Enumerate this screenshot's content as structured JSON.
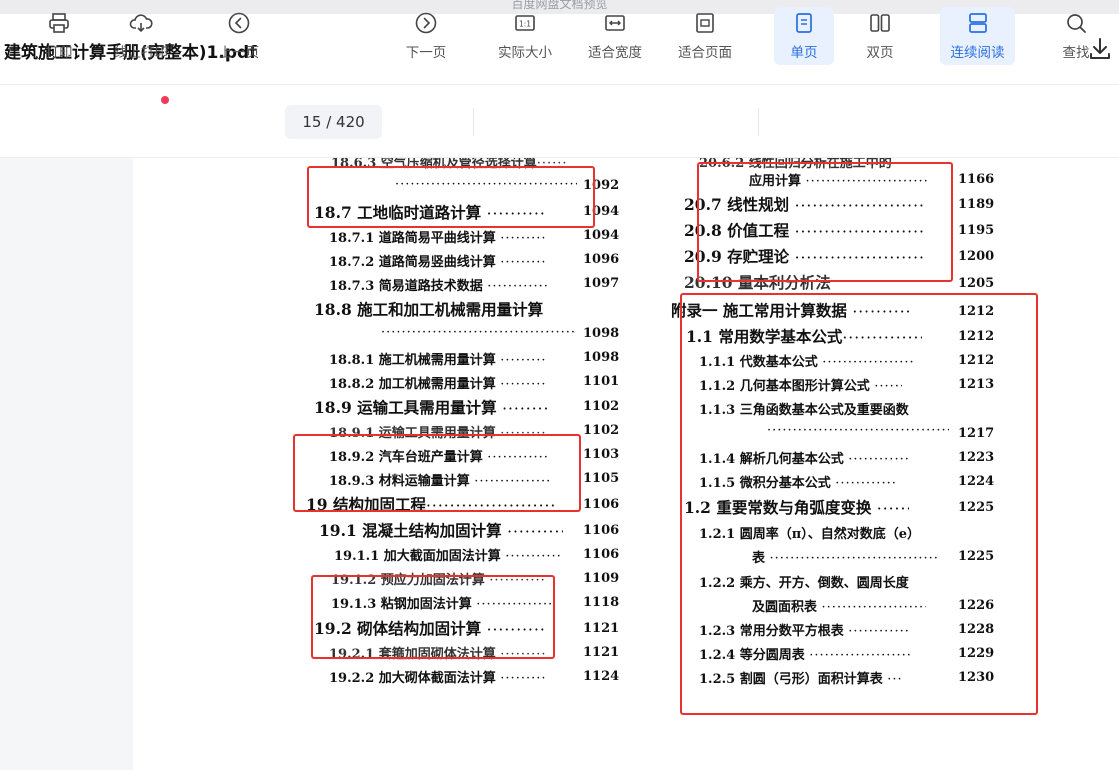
{
  "window": {
    "top_caption": "百度网盘文档预览",
    "doc_title": "建筑施工计算手册(完整本)1.pdf"
  },
  "toolbar": {
    "print": "打印",
    "online_print": "线上打印",
    "prev_page": "上一页",
    "page_indicator": "15 / 420",
    "next_page": "下一页",
    "actual_size": "实际大小",
    "fit_width": "适合宽度",
    "fit_page": "适合页面",
    "single_page": "单页",
    "double_page": "双页",
    "continuous": "连续阅读",
    "search": "查找",
    "actual_size_glyph": "1:1"
  },
  "toc_left": [
    {
      "text": "18.6.3  空气压缩机及管径选择计算",
      "page": ""
    },
    {
      "text": "",
      "page": "1092"
    },
    {
      "text": "18.7   工地临时道路计算",
      "page": "1094"
    },
    {
      "text": "18.7.1   道路简易平曲线计算",
      "page": "1094"
    },
    {
      "text": "18.7.2   道路简易竖曲线计算",
      "page": "1096"
    },
    {
      "text": "18.7.3   简易道路技术数据",
      "page": "1097"
    },
    {
      "text": "18.8   施工和加工机械需用量计算",
      "page": ""
    },
    {
      "text": "",
      "page": "1098"
    },
    {
      "text": "18.8.1   施工机械需用量计算",
      "page": "1098"
    },
    {
      "text": "18.8.2   加工机械需用量计算",
      "page": "1101"
    },
    {
      "text": "18.9   运输工具需用量计算",
      "page": "1102"
    },
    {
      "text": "18.9.1   运输工具需用量计算",
      "page": "1102"
    },
    {
      "text": "18.9.2   汽车台班产量计算",
      "page": "1103"
    },
    {
      "text": "18.9.3   材料运输量计算",
      "page": "1105"
    },
    {
      "text": "19   结构加固工程",
      "page": "1106"
    },
    {
      "text": "19.1   混凝土结构加固计算",
      "page": "1106"
    },
    {
      "text": "19.1.1   加大截面加固法计算",
      "page": "1106"
    },
    {
      "text": "19.1.2   预应力加固法计算",
      "page": "1109"
    },
    {
      "text": "19.1.3   粘钢加固法计算",
      "page": "1118"
    },
    {
      "text": "19.2   砌体结构加固计算",
      "page": "1121"
    },
    {
      "text": "19.2.1   套箍加固砌体法计算",
      "page": "1121"
    },
    {
      "text": "19.2.2   加大砌体截面法计算",
      "page": "1124"
    }
  ],
  "toc_right": [
    {
      "text": "20.6.2  线性回归分析在施工中的",
      "page": ""
    },
    {
      "text": "应用计算",
      "page": "1166"
    },
    {
      "text": "20.7   线性规划",
      "page": "1189"
    },
    {
      "text": "20.8   价值工程",
      "page": "1195"
    },
    {
      "text": "20.9   存贮理论",
      "page": "1200"
    },
    {
      "text": "20.10   量本利分析法",
      "page": "1205"
    },
    {
      "text": "附录一   施工常用计算数据",
      "page": "1212"
    },
    {
      "text": "1.1   常用数学基本公式",
      "page": "1212"
    },
    {
      "text": "1.1.1   代数基本公式",
      "page": "1212"
    },
    {
      "text": "1.1.2   几何基本图形计算公式",
      "page": "1213"
    },
    {
      "text": "1.1.3   三角函数基本公式及重要函数",
      "page": ""
    },
    {
      "text": "",
      "page": "1217"
    },
    {
      "text": "1.1.4   解析几何基本公式",
      "page": "1223"
    },
    {
      "text": "1.1.5   微积分基本公式",
      "page": "1224"
    },
    {
      "text": "1.2   重要常数与角弧度变换",
      "page": "1225"
    },
    {
      "text": "1.2.1   圆周率（π）、自然对数底（e）",
      "page": ""
    },
    {
      "text": "表",
      "page": "1225"
    },
    {
      "text": "1.2.2   乘方、开方、倒数、圆周长度",
      "page": ""
    },
    {
      "text": "及圆面积表",
      "page": "1226"
    },
    {
      "text": "1.2.3   常用分数平方根表",
      "page": "1228"
    },
    {
      "text": "1.2.4   等分圆周表",
      "page": "1229"
    },
    {
      "text": "1.2.5   割圆（弓形）面积计算表",
      "page": "1230"
    }
  ],
  "colors": {
    "highlight_red": "#e8322f",
    "active_blue": "#2a6fe0",
    "active_bg": "#e8f1fd"
  }
}
